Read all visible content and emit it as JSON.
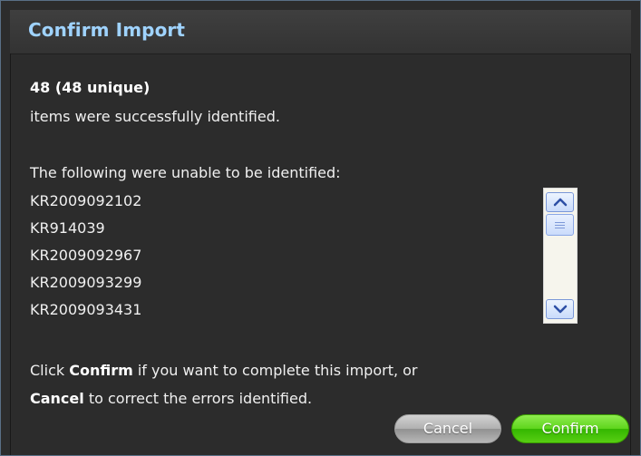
{
  "dialog": {
    "title": "Confirm Import",
    "summary": {
      "count_line": "48 (48 unique)",
      "success_line": "items were successfully identified."
    },
    "failed": {
      "header": "The following were unable to be identified:",
      "items": [
        "KR2009092102",
        "KR914039",
        "KR2009092967",
        "KR2009093299",
        "KR2009093431"
      ]
    },
    "instructions": {
      "line1_prefix": "Click ",
      "confirm_word": "Confirm",
      "line1_suffix": " if you want to complete this import, or",
      "cancel_word": "Cancel",
      "line2_suffix": " to correct the errors identified."
    },
    "buttons": {
      "cancel_label": "Cancel",
      "confirm_label": "Confirm"
    }
  },
  "icons": {
    "scroll_up": "chevron-up-icon",
    "scroll_down": "chevron-down-icon"
  },
  "colors": {
    "title": "#9fd3ff",
    "dialog_bg": "#2c2c2c",
    "confirm": "#5ed51c",
    "cancel": "#b0b0b0"
  }
}
